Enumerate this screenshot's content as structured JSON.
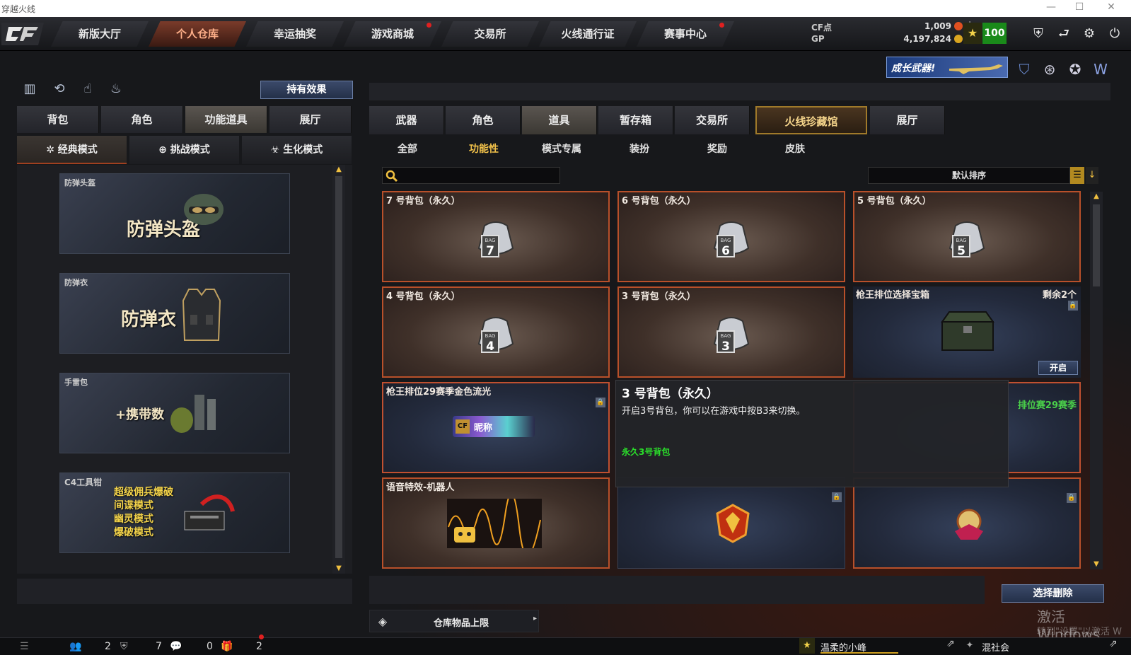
{
  "window": {
    "title": "穿越火线",
    "controls": [
      "—",
      "☐",
      "✕"
    ]
  },
  "topnav": {
    "tabs": [
      {
        "label": "新版大厅",
        "dot": false,
        "active": false
      },
      {
        "label": "个人仓库",
        "dot": false,
        "active": true
      },
      {
        "label": "幸运抽奖",
        "dot": false,
        "active": false
      },
      {
        "label": "游戏商城",
        "dot": true,
        "active": false
      },
      {
        "label": "交易所",
        "dot": false,
        "active": false
      },
      {
        "label": "火线通行证",
        "dot": false,
        "active": false
      },
      {
        "label": "赛事中心",
        "dot": true,
        "active": false
      }
    ],
    "currency": {
      "cf_label": "CF点",
      "cf_value": "1,009",
      "gp_label": "GP",
      "gp_value": "4,197,824"
    },
    "rank": "100",
    "icons": [
      "shield-icon",
      "return-icon",
      "settings-icon",
      "power-icon"
    ]
  },
  "banner": {
    "label": "成长武器!"
  },
  "left": {
    "effect_button": "持有效果",
    "tabs": [
      "背包",
      "角色",
      "功能道具",
      "展厅"
    ],
    "active_tab": 2,
    "modes": [
      "经典模式",
      "挑战模式",
      "生化模式"
    ],
    "cards": [
      {
        "category": "防弹头盔",
        "title": "防弹头盔"
      },
      {
        "category": "防弹衣",
        "title": "防弹衣"
      },
      {
        "category": "手雷包",
        "title": "+携带数"
      },
      {
        "category": "C4工具钳",
        "lines": [
          "超级佣兵爆破",
          "间谍模式",
          "幽灵模式",
          "爆破模式"
        ]
      }
    ]
  },
  "right": {
    "tabs": [
      "武器",
      "角色",
      "道具",
      "暂存箱",
      "交易所",
      "火线珍藏馆",
      "展厅"
    ],
    "active_tab": 2,
    "subtabs": [
      "全部",
      "功能性",
      "模式专属",
      "装扮",
      "奖励",
      "皮肤"
    ],
    "active_subtab": 1,
    "search": {
      "placeholder": ""
    },
    "sort_label": "默认排序",
    "items": [
      {
        "name": "7 号背包（永久）",
        "bag": "7"
      },
      {
        "name": "6 号背包（永久）",
        "bag": "6"
      },
      {
        "name": "5 号背包（永久）",
        "bag": "5"
      },
      {
        "name": "4 号背包（永久）",
        "bag": "4"
      },
      {
        "name": "3 号背包（永久）",
        "bag": "3"
      },
      {
        "name": "枪王排位选择宝箱",
        "remain": "剩余2个",
        "open": "开启"
      },
      {
        "name": "枪王排位29赛季金色流光",
        "tag": "昵称"
      },
      {
        "name": "排位赛29赛季"
      },
      {
        "name": "语音特效-机器人"
      }
    ],
    "tooltip": {
      "title": "3 号背包（永久）",
      "desc": "开启3号背包，你可以在游戏中按B3来切换。",
      "green": "永久3号背包"
    },
    "delete_button": "选择删除",
    "capacity_label": "仓库物品上限"
  },
  "watermark": {
    "line1": "激活 Windows",
    "line2": "转到\"设置\"以激活 W"
  },
  "bottom": {
    "counts": [
      "2",
      "7",
      "0",
      "2"
    ],
    "friend1": "温柔的小峰",
    "friend2": "混社会"
  },
  "colors": {
    "accent": "#b8502a",
    "gold": "#f3c24a",
    "green": "#2adf2a"
  }
}
